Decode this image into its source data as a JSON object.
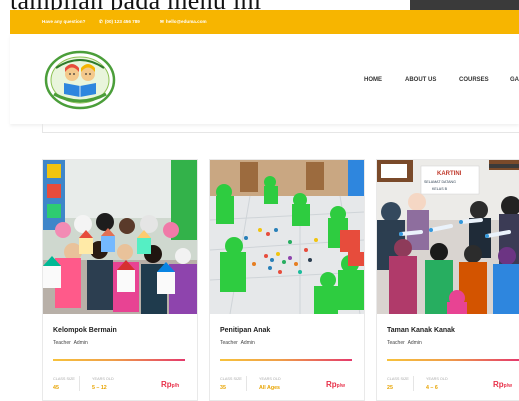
{
  "caption": "tampilan pada menu ini",
  "topbar": {
    "question": "Have any question?",
    "phone": "(00) 123 456 789",
    "email": "hello@eduma.com",
    "color": "#f7b500"
  },
  "nav": {
    "items": [
      "HOME",
      "ABOUT US",
      "COURSES",
      "GA"
    ]
  },
  "courses": [
    {
      "title": "Kelompok Bermain",
      "teacher_label": "Teacher",
      "teacher": "Admin",
      "class_size_label": "CLASS SIZE",
      "class_size": "45",
      "years_label": "YEARS OLD",
      "years": "5 – 12",
      "price": "Rp",
      "unit": "p/h"
    },
    {
      "title": "Penitipan Anak",
      "teacher_label": "Teacher",
      "teacher": "Admin",
      "class_size_label": "CLASS SIZE",
      "class_size": "35",
      "years_label": "YEARS OLD",
      "years": "All Ages",
      "price": "Rp",
      "unit": "p/w"
    },
    {
      "title": "Taman Kanak Kanak",
      "teacher_label": "Teacher",
      "teacher": "Admin",
      "class_size_label": "CLASS SIZE",
      "class_size": "25",
      "years_label": "YEARS OLD",
      "years": "4 – 6",
      "price": "Rp",
      "unit": "p/w"
    }
  ],
  "photo3_sign": [
    "KARTINI",
    "SELAMAT DATANG",
    "KELAS B"
  ],
  "icons": [
    "phone-icon",
    "mail-icon"
  ],
  "colors": {
    "accent": "#f7b500",
    "price": "#e8314a",
    "value": "#e8a400"
  }
}
